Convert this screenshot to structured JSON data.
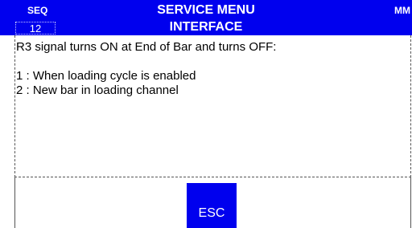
{
  "header": {
    "left_label": "SEQ",
    "sequence_number": "12",
    "title": "SERVICE MENU",
    "subtitle": "INTERFACE",
    "unit": "MM",
    "background_color": "#0000ee"
  },
  "message": {
    "lines": [
      "R3 signal turns ON at End of Bar and turns OFF:",
      "1 : When loading cycle is enabled",
      "2 : New bar in loading channel"
    ]
  },
  "footer": {
    "esc_label": "ESC"
  }
}
